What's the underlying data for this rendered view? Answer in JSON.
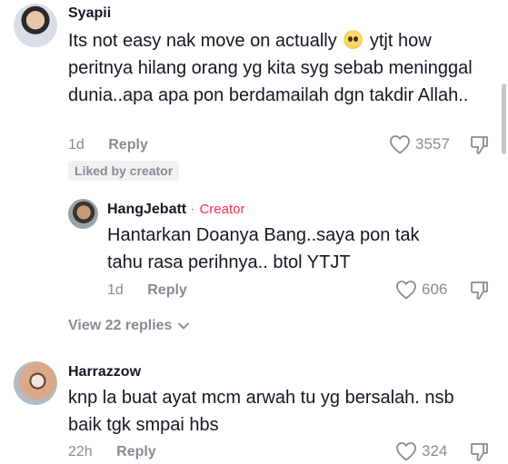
{
  "comments": [
    {
      "username": "Syapii",
      "text_before_emoji": "Its not easy nak move on actually",
      "emoji": "pleading-face-emoji",
      "text_after_emoji": "ytjt how peritnya hilang orang yg kita syg sebab meninggal dunia..apa apa pon berdamailah dgn takdir Allah..",
      "time": "1d",
      "reply_label": "Reply",
      "likes": "3557",
      "badge": "Liked by creator"
    },
    {
      "username": "HangJebatt",
      "creator_separator": "·",
      "creator_label": "Creator",
      "text": "Hantarkan Doanya Bang..saya pon tak tahu rasa perihnya.. btol YTJT",
      "time": "1d",
      "reply_label": "Reply",
      "likes": "606"
    },
    {
      "username": "Harrazzow",
      "text": "knp la buat ayat mcm arwah tu yg bersalah. nsb baik tgk smpai hbs",
      "time": "22h",
      "reply_label": "Reply",
      "likes": "324"
    }
  ],
  "view_replies": "View 22 replies",
  "colors": {
    "text": "#161823",
    "muted": "#8a8b91",
    "creator": "#fe2c55"
  }
}
